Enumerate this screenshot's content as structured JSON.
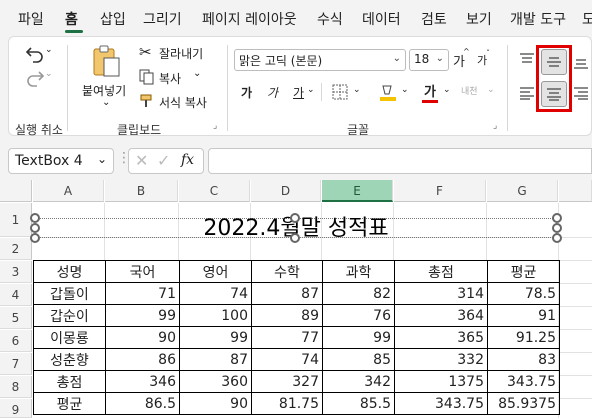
{
  "menu": {
    "items": [
      "파일",
      "홈",
      "삽입",
      "그리기",
      "페이지 레이아웃",
      "수식",
      "데이터",
      "검토",
      "보기",
      "개발 도구",
      "도"
    ],
    "active_index": 1
  },
  "ribbon": {
    "undo_group_label": "실행 취소",
    "clipboard": {
      "paste_label": "붙여넣기",
      "cut_label": "잘라내기",
      "copy_label": "복사",
      "format_painter_label": "서식 복사",
      "group_label": "클립보드"
    },
    "font": {
      "font_name": "맑은 고딕 (본문)",
      "font_size": "18",
      "grow_label": "가",
      "shrink_label": "가",
      "bold_label": "가",
      "italic_label": "가",
      "underline_label": "가",
      "font_color_label": "가",
      "phonetic_label": "내천",
      "group_label": "글꼴"
    },
    "accent_color": "#1e7145",
    "highlight_color": "#e00000"
  },
  "formula_bar": {
    "name_box": "TextBox 4",
    "fx_label": "fx",
    "formula": ""
  },
  "sheet": {
    "columns": [
      "A",
      "B",
      "C",
      "D",
      "E",
      "F",
      "G"
    ],
    "selected_column": "E",
    "rows": [
      "1",
      "2",
      "3",
      "4",
      "5",
      "6",
      "7",
      "8",
      "9"
    ],
    "title": "2022.4월말 성적표",
    "table": {
      "headers": [
        "성명",
        "국어",
        "영어",
        "수학",
        "과학",
        "총점",
        "평균"
      ],
      "rows": [
        [
          "갑돌이",
          "71",
          "74",
          "87",
          "82",
          "314",
          "78.5"
        ],
        [
          "갑순이",
          "99",
          "100",
          "89",
          "76",
          "364",
          "91"
        ],
        [
          "이몽룡",
          "90",
          "99",
          "77",
          "99",
          "365",
          "91.25"
        ],
        [
          "성춘향",
          "86",
          "87",
          "74",
          "85",
          "332",
          "83"
        ],
        [
          "총점",
          "346",
          "360",
          "327",
          "342",
          "1375",
          "343.75"
        ],
        [
          "평균",
          "86.5",
          "90",
          "81.75",
          "85.5",
          "343.75",
          "85.9375"
        ]
      ]
    }
  }
}
